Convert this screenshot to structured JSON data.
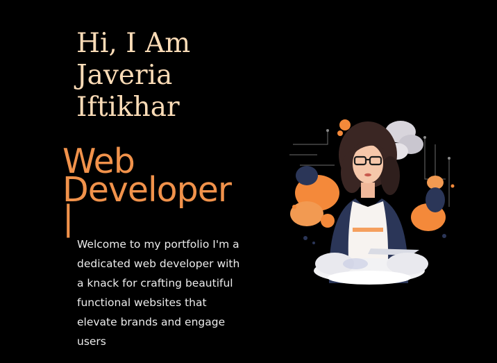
{
  "hero": {
    "greeting_lines": [
      "Hi, I Am",
      "Javeria",
      "Iftikhar"
    ],
    "role_lines": [
      "Web",
      "Developer"
    ],
    "cursor": "|",
    "intro": "Welcome to my portfolio I'm a dedicated web developer with a knack for crafting beautiful functional websites that elevate brands and engage users"
  },
  "colors": {
    "background": "#000000",
    "heading": "#fcdcb7",
    "accent": "#f1924b",
    "body_text": "#ececec"
  },
  "illustration": {
    "icon": "developer-illustration"
  }
}
